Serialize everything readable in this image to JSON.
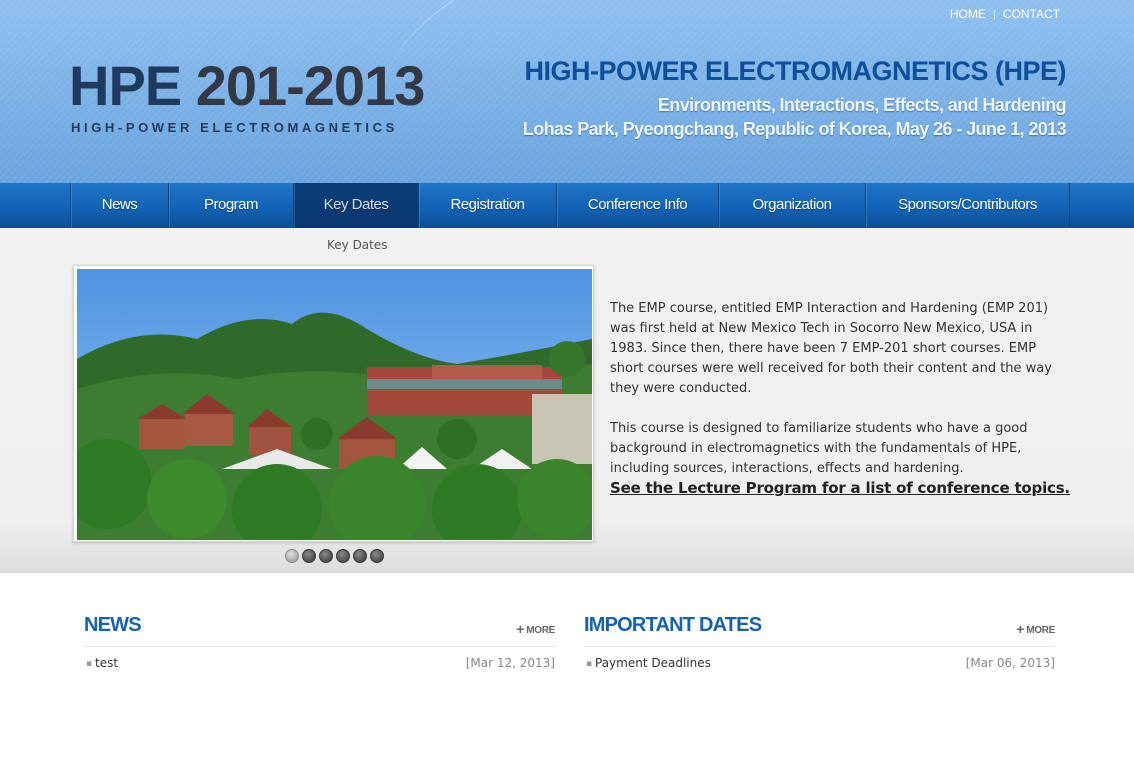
{
  "top_links": {
    "home": "HOME",
    "contact": "CONTACT"
  },
  "logo": {
    "prefix": "HPE ",
    "year": "201-2013",
    "subtitle": "HIGH-POWER ELECTROMAGNETICS"
  },
  "conference": {
    "title": "HIGH-POWER ELECTROMAGNETICS (HPE)",
    "subtitle": "Environments, Interactions, Effects, and Hardening",
    "location": "Lohas Park, Pyeongchang, Republic of Korea,  May 26 - June 1, 2013"
  },
  "nav": {
    "items": [
      {
        "label": "News"
      },
      {
        "label": "Program"
      },
      {
        "label": "Key Dates"
      },
      {
        "label": "Registration"
      },
      {
        "label": "Conference Info"
      },
      {
        "label": "Organization"
      },
      {
        "label": "Sponsors/Contributors"
      }
    ],
    "active": "Key Dates"
  },
  "breadcrumb": "Key Dates",
  "slideshow": {
    "count": 6,
    "active_index": 0,
    "image": "resort-photo"
  },
  "intro": {
    "p1": "The EMP course, entitled EMP Interaction and Hardening (EMP 201) was first held at New Mexico Tech in Socorro New Mexico, USA in 1983. Since then, there have been 7 EMP-201 short courses. EMP short courses were well received for both their content and the way they were conducted.",
    "p2": "This course is designed to familiarize students who have a good background in electromagnetics with the fundamentals of HPE, including sources, interactions, effects and hardening.",
    "link": "See the Lecture Program for a list of conference topics."
  },
  "news": {
    "title": "NEWS",
    "more": "MORE",
    "items": [
      {
        "text": "test",
        "date": "[Mar 12, 2013]"
      }
    ]
  },
  "important_dates": {
    "title": "IMPORTANT DATES",
    "more": "MORE",
    "items": [
      {
        "text": "Payment Deadlines",
        "date": "[Mar 06, 2013]"
      }
    ]
  },
  "colors": {
    "nav_blue": "#1363b5",
    "accent_blue": "#1462b0",
    "header_blue": "#7eb3e8"
  }
}
